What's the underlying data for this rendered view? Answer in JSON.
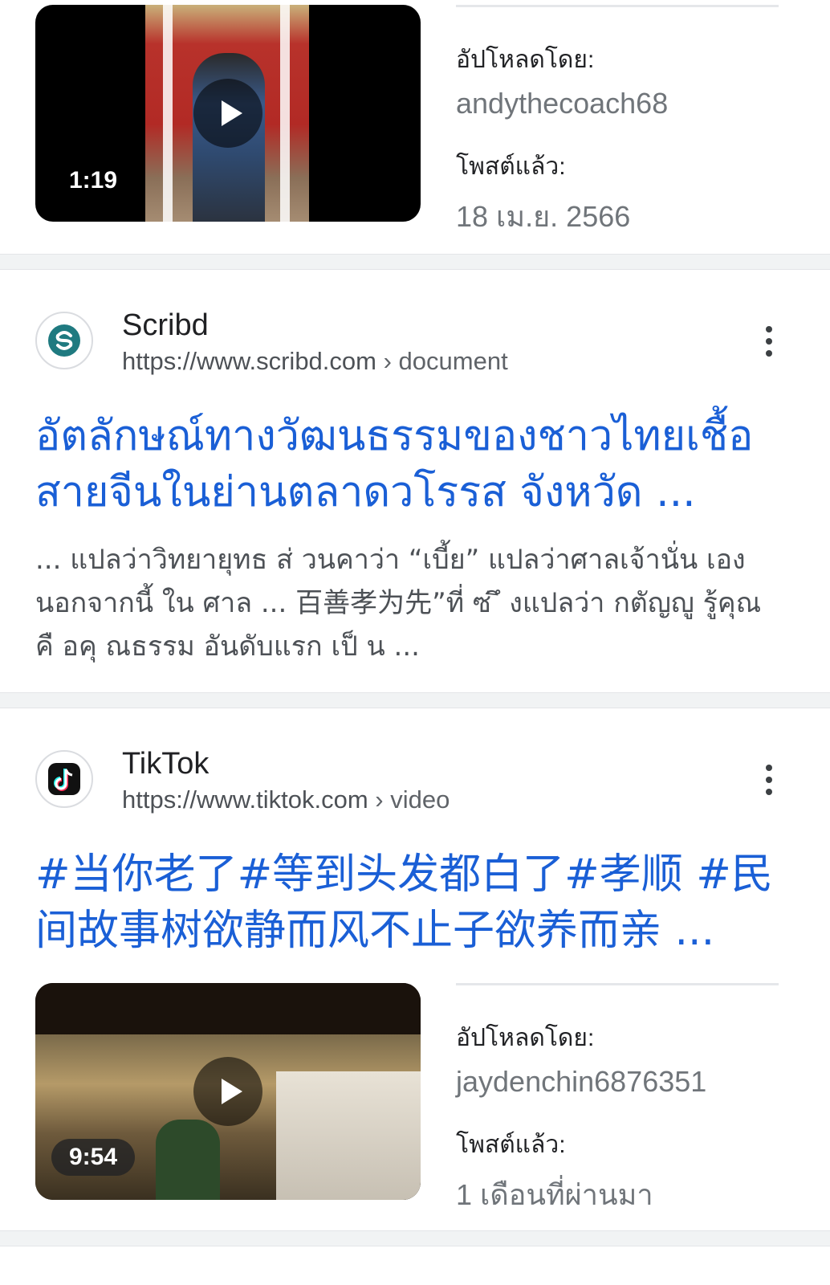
{
  "result1": {
    "duration": "1:19",
    "uploaded_label": "อัปโหลดโดย:",
    "uploader": "andythecoach68",
    "posted_label": "โพสต์แล้ว:",
    "posted": "18 เม.ย. 2566"
  },
  "result2": {
    "source": "Scribd",
    "url": "https://www.scribd.com",
    "breadcrumb": "› document",
    "favicon": "scribd-logo-icon",
    "title": "อัตลักษณ์ทางวัฒนธรรมของชาวไทยเชื้อสายจีนในย่านตลาดวโรรส จังหวัด ...",
    "snippet": "... แปลว่าวิทยายุทธ ส่ วนคาว่า “เบี้ย” แปลว่าศาลเจ้านั่น เอง นอกจากนี้ ใน ศาล ... 百善孝为先”ที่ ซ่ ึ งแปลว่า กตัญญู รู้คุณ คื อคุ ณธรรม อันดับแรก เป็ น ..."
  },
  "result3": {
    "source": "TikTok",
    "url": "https://www.tiktok.com",
    "breadcrumb": "› video",
    "favicon": "tiktok-logo-icon",
    "title": "#当你老了#等到头发都白了#孝顺 #民间故事树欲静而风不止子欲养而亲 ...",
    "duration": "9:54",
    "uploaded_label": "อัปโหลดโดย:",
    "uploader": "jaydenchin6876351",
    "posted_label": "โพสต์แล้ว:",
    "posted": "1 เดือนที่ผ่านมา"
  },
  "colors": {
    "link": "#1a5fd6",
    "muted": "#70757a",
    "divider": "#f1f3f4"
  }
}
